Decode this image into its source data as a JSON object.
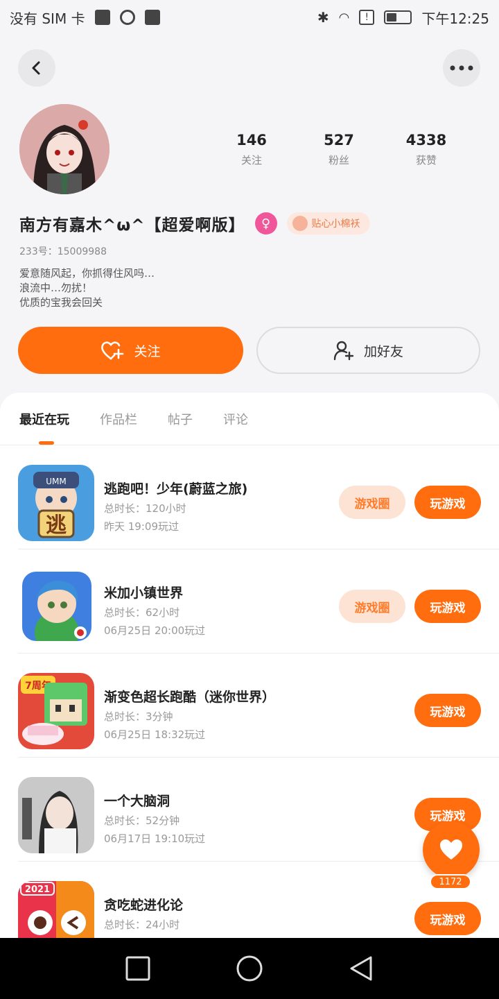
{
  "status_bar": {
    "carrier": "没有 SIM 卡",
    "time": "下午12:25"
  },
  "profile": {
    "stats": [
      {
        "num": "146",
        "label": "关注"
      },
      {
        "num": "527",
        "label": "粉丝"
      },
      {
        "num": "4338",
        "label": "获赞"
      }
    ],
    "name": "南方有嘉木^ω^【超爱啊版】",
    "gender_symbol": "♀",
    "tag_label": "贴心小棉袄",
    "uid": "233号：15009988",
    "bio": [
      "爱意随风起，你抓得住风吗…",
      "浪流中…勿扰！",
      "优质的宝我会回关"
    ],
    "follow_label": "关注",
    "add_friend_label": "加好友"
  },
  "tabs": [
    {
      "label": "最近在玩",
      "active": true
    },
    {
      "label": "作品栏",
      "active": false
    },
    {
      "label": "帖子",
      "active": false
    },
    {
      "label": "评论",
      "active": false
    }
  ],
  "games": [
    {
      "title": "逃跑吧！少年(蔚蓝之旅)",
      "duration": "总时长：120小时",
      "last": "昨天 19:09玩过",
      "circle": "游戏圈",
      "play": "玩游戏"
    },
    {
      "title": "米加小镇世界",
      "duration": "总时长：62小时",
      "last": "06月25日 20:00玩过",
      "circle": "游戏圈",
      "play": "玩游戏"
    },
    {
      "title": "渐变色超长跑酷（迷你世界）",
      "duration": "总时长：3分钟",
      "last": "06月25日 18:32玩过",
      "circle": "",
      "play": "玩游戏"
    },
    {
      "title": "一个大脑洞",
      "duration": "总时长：52分钟",
      "last": "06月17日 19:10玩过",
      "circle": "",
      "play": "玩游戏"
    },
    {
      "title": "贪吃蛇进化论",
      "duration": "总时长：24小时",
      "last": "",
      "circle": "",
      "play": "玩游戏"
    }
  ],
  "icon_text": {
    "game1": "逃",
    "game1_badge": "UMM",
    "game3_badge": "7周年",
    "game5_badge": "2021"
  },
  "like_count": "1172",
  "colors": {
    "accent": "#ff6d0f",
    "accent_soft": "#fde3d3"
  }
}
